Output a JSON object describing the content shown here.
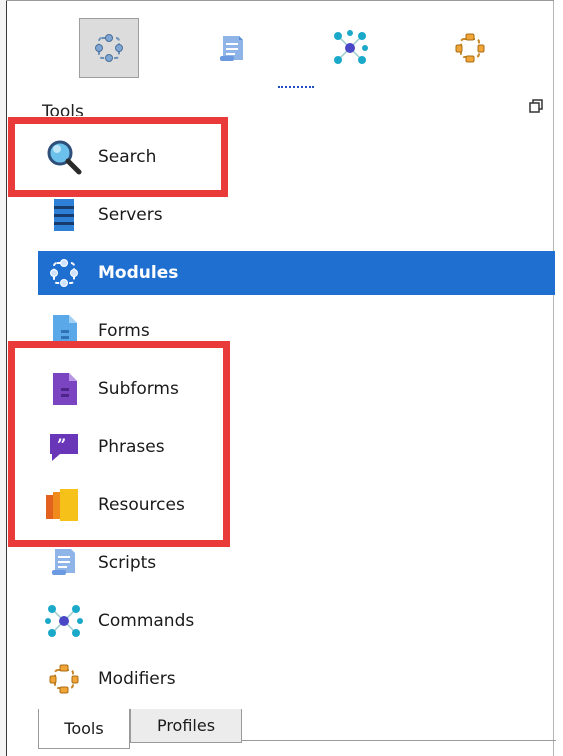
{
  "toolbar": {
    "buttons": [
      {
        "icon": "modules-icon",
        "active": true
      },
      {
        "icon": "scripts-icon",
        "active": false
      },
      {
        "icon": "commands-icon",
        "active": false
      },
      {
        "icon": "modifiers-icon",
        "active": false
      }
    ]
  },
  "panel": {
    "title": "Tools",
    "items": [
      {
        "label": "Search",
        "icon": "search-icon"
      },
      {
        "label": "Servers",
        "icon": "server-icon"
      },
      {
        "label": "Modules",
        "icon": "modules-icon",
        "selected": true
      },
      {
        "label": "Forms",
        "icon": "form-icon"
      },
      {
        "label": "Subforms",
        "icon": "subform-icon"
      },
      {
        "label": "Phrases",
        "icon": "phrase-icon"
      },
      {
        "label": "Resources",
        "icon": "resources-icon"
      },
      {
        "label": "Scripts",
        "icon": "scripts-icon"
      },
      {
        "label": "Commands",
        "icon": "commands-icon"
      },
      {
        "label": "Modifiers",
        "icon": "modifiers-icon"
      }
    ]
  },
  "tabs": [
    {
      "label": "Tools",
      "active": true
    },
    {
      "label": "Profiles",
      "active": false
    }
  ],
  "colors": {
    "selection": "#1f6fd1",
    "highlight": "#ea3b3b"
  }
}
